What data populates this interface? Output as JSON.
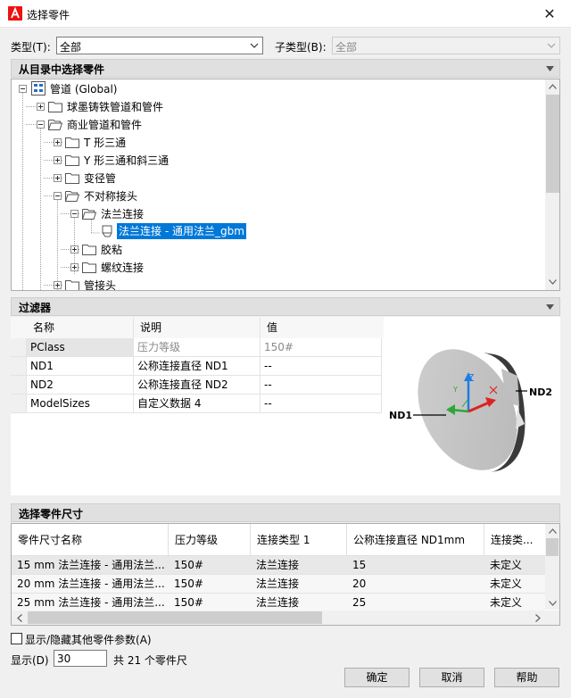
{
  "window": {
    "title": "选择零件",
    "close_glyph": "✕"
  },
  "type_label": "类型(T):",
  "type_value": "全部",
  "subtype_label": "子类型(B):",
  "subtype_value": "全部",
  "catalog": {
    "header": "从目录中选择零件",
    "nodes": [
      {
        "label": "管道 (Global)"
      },
      {
        "label": "球墨铸铁管道和管件"
      },
      {
        "label": "商业管道和管件"
      },
      {
        "label": "T 形三通"
      },
      {
        "label": "Y 形三通和斜三通"
      },
      {
        "label": "变径管"
      },
      {
        "label": "不对称接头"
      },
      {
        "label": "法兰连接"
      },
      {
        "label": "法兰连接 - 通用法兰_gbm"
      },
      {
        "label": "胶粘"
      },
      {
        "label": "螺纹连接"
      },
      {
        "label": "管接头"
      }
    ]
  },
  "filter": {
    "header": "过滤器",
    "columns": [
      "名称",
      "说明",
      "值"
    ],
    "rows": [
      {
        "name": "PClass",
        "desc": "压力等级",
        "value": "150#"
      },
      {
        "name": "ND1",
        "desc": "公称连接直径 ND1",
        "value": "--"
      },
      {
        "name": "ND2",
        "desc": "公称连接直径 ND2",
        "value": "--"
      },
      {
        "name": "ModelSizes",
        "desc": "自定义数据 4",
        "value": "--"
      }
    ],
    "preview": {
      "nd1": "ND1",
      "nd2": "ND2",
      "axis_z": "Z",
      "axis_y": "Y"
    }
  },
  "sizes": {
    "header": "选择零件尺寸",
    "columns": [
      "零件尺寸名称",
      "压力等级",
      "连接类型 1",
      "公称连接直径 ND1mm",
      "连接类..."
    ],
    "rows": [
      [
        "15 mm 法兰连接 - 通用法兰...",
        "150#",
        "法兰连接",
        "15",
        "未定义"
      ],
      [
        "20 mm 法兰连接 - 通用法兰...",
        "150#",
        "法兰连接",
        "20",
        "未定义"
      ],
      [
        "25 mm 法兰连接 - 通用法兰...",
        "150#",
        "法兰连接",
        "25",
        "未定义"
      ]
    ]
  },
  "show_hide_label": "显示/隐藏其他零件参数(A)",
  "show_label": "显示(D)",
  "show_value": "30",
  "total_text": "共 21 个零件尺",
  "buttons": {
    "ok": "确定",
    "cancel": "取消",
    "help": "帮助"
  }
}
